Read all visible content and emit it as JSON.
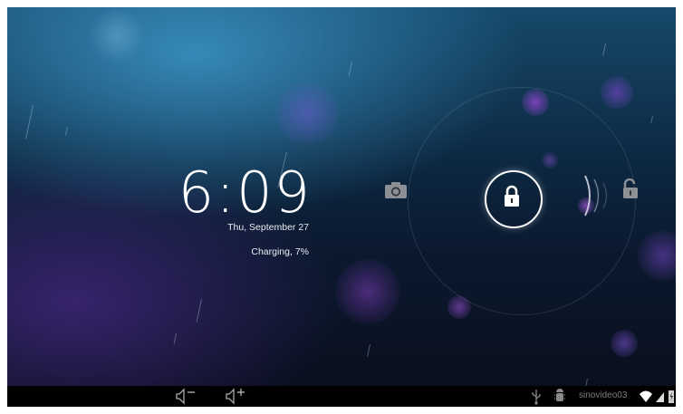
{
  "lockscreen": {
    "time": "6:09",
    "date": "Thu, September 27",
    "charging": "Charging, 7%"
  },
  "icons": {
    "camera": "camera-icon",
    "lock": "lock-icon",
    "unlock": "unlock-icon",
    "volume_down": "volume-down-icon",
    "volume_up": "volume-up-icon",
    "usb": "usb-icon",
    "debug": "android-debug-icon",
    "wifi": "wifi-icon",
    "signal": "signal-icon",
    "battery": "battery-charging-icon"
  },
  "status_bar": {
    "network_name": "sinovideo03"
  },
  "colors": {
    "accent": "#ffffff",
    "status_text": "#7b7b7b",
    "navbar": "#000000"
  }
}
